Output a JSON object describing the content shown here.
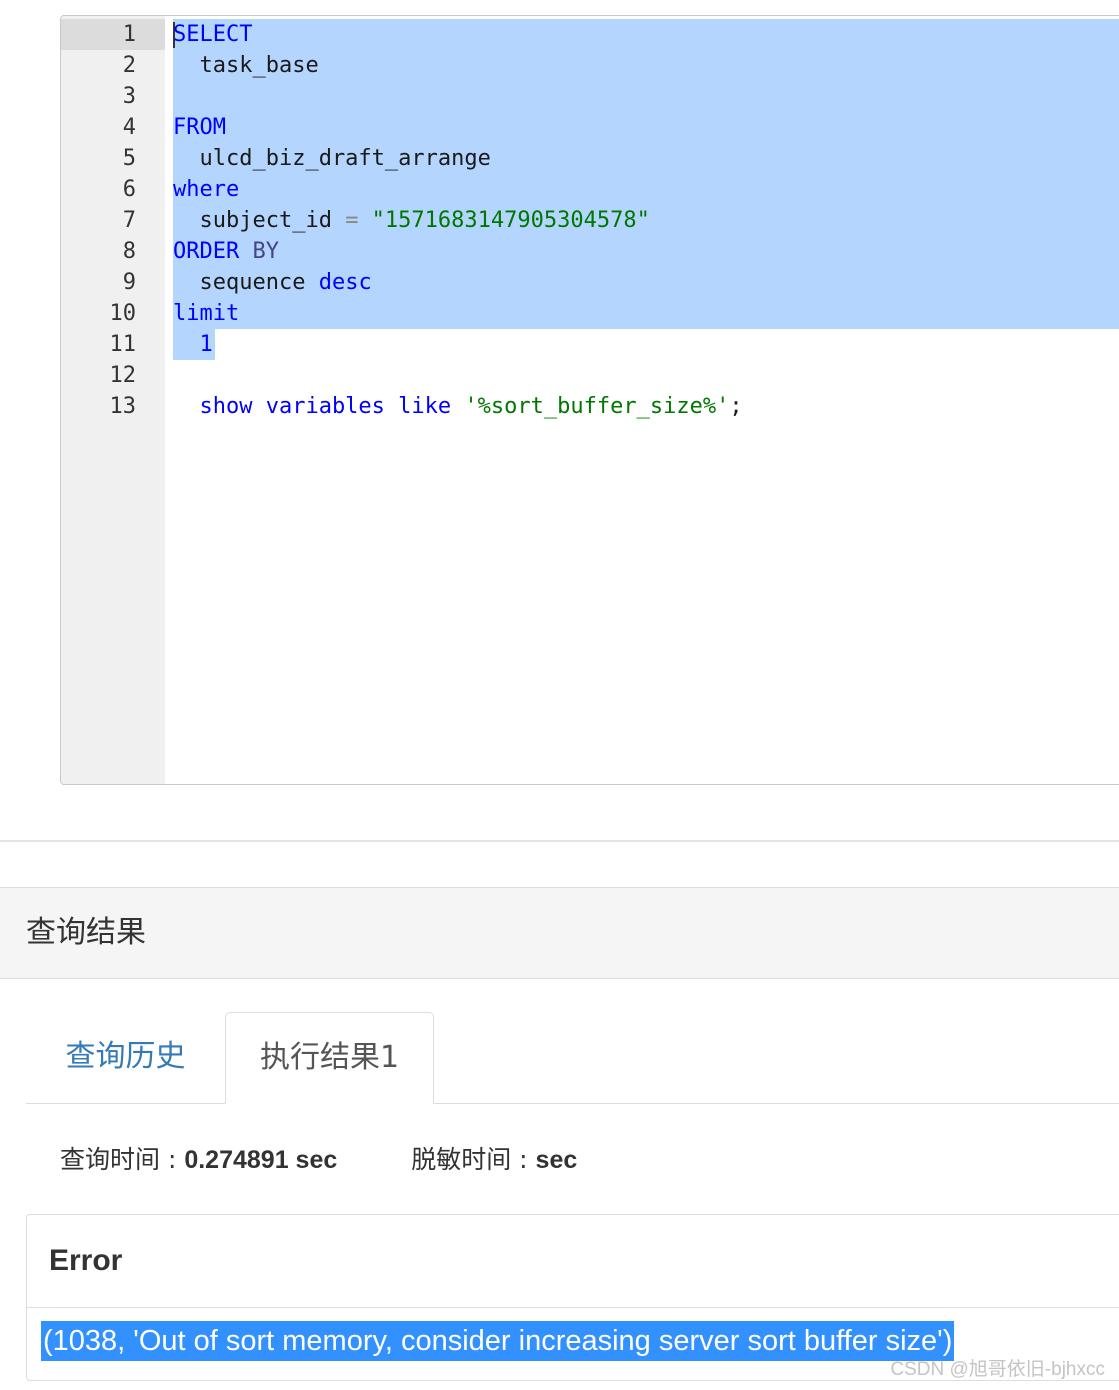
{
  "editor": {
    "line_numbers": [
      "1",
      "2",
      "3",
      "4",
      "5",
      "6",
      "7",
      "8",
      "9",
      "10",
      "11",
      "12",
      "13"
    ],
    "lines": {
      "l1_kw": "SELECT",
      "l2_text": "  task_base",
      "l4_kw": "FROM",
      "l5_text": "  ulcd_biz_draft_arrange",
      "l6_kw": "where",
      "l7_ident": "  subject_id ",
      "l7_op": "=",
      "l7_str": " \"1571683147905304578\"",
      "l8_kw": "ORDER",
      "l8_kw2": " BY",
      "l9_ident": "  sequence ",
      "l9_kw": "desc",
      "l10_kw": "limit",
      "l11_num": "  1",
      "l13_kw": "  show variables like ",
      "l13_str": "'%sort_buffer_size%'",
      "l13_tail": ";"
    }
  },
  "results": {
    "title": "查询结果",
    "tabs": {
      "history": "查询历史",
      "result": "执行结果1"
    },
    "stats": {
      "query_time_label": "查询时间 : ",
      "query_time_value": "0.274891 sec",
      "mask_time_label": "脱敏时间 : ",
      "mask_time_value": "sec"
    },
    "error": {
      "title": "Error",
      "message": "(1038, 'Out of sort memory, consider increasing server sort buffer size')"
    }
  },
  "watermark": "CSDN @旭哥依旧-bjhxcc",
  "colors": {
    "selection": "#b4d5fe",
    "keyword": "#0000ff",
    "string": "#007700",
    "link": "#337ab7",
    "error_highlight": "#3390ff"
  }
}
